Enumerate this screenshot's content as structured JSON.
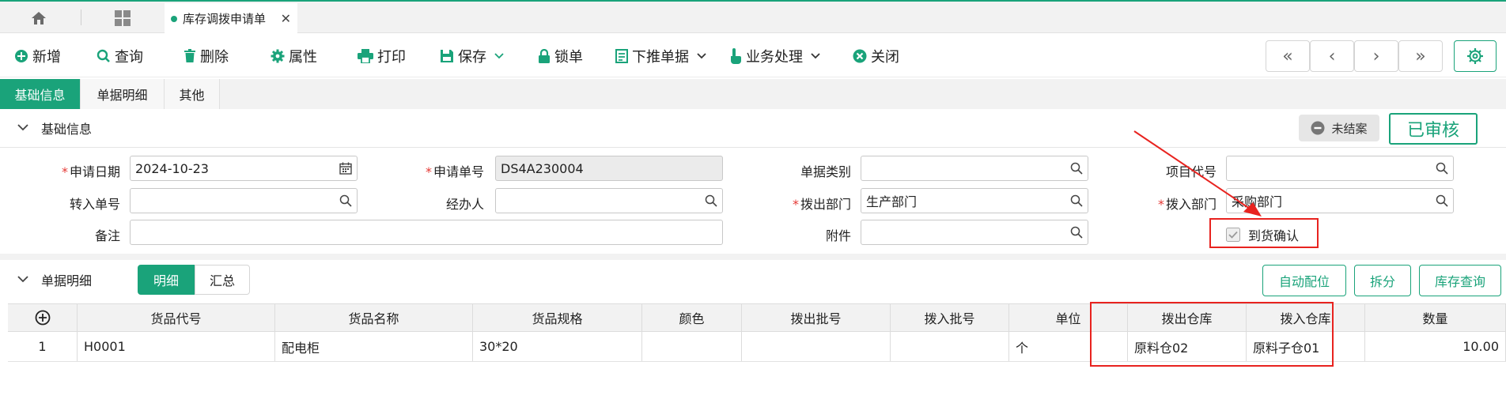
{
  "tabs": {
    "home_icon": "home-icon",
    "apps_icon": "grid-icon",
    "active_label": "库存调拨申请单",
    "close": "✕"
  },
  "toolbar": {
    "new": "新增",
    "query": "查询",
    "delete": "删除",
    "props": "属性",
    "print": "打印",
    "save": "保存",
    "lock": "锁单",
    "push_down": "下推单据",
    "business": "业务处理",
    "close": "关闭",
    "nav": [
      "«",
      "‹",
      "›",
      "»"
    ]
  },
  "section_tabs": [
    "基础信息",
    "单据明细",
    "其他"
  ],
  "basic": {
    "title": "基础信息",
    "status_open": "未结案",
    "status_approved": "已审核",
    "fields": {
      "apply_date_label": "申请日期",
      "apply_date_value": "2024-10-23",
      "apply_no_label": "申请单号",
      "apply_no_value": "DS4A230004",
      "doc_type_label": "单据类别",
      "doc_type_value": "",
      "project_label": "项目代号",
      "project_value": "",
      "in_no_label": "转入单号",
      "in_no_value": "",
      "handler_label": "经办人",
      "handler_value": "",
      "out_dept_label": "拨出部门",
      "out_dept_value": "生产部门",
      "in_dept_label": "拨入部门",
      "in_dept_value": "采购部门",
      "remark_label": "备注",
      "remark_value": "",
      "attach_label": "附件",
      "attach_value": "",
      "arrival_label": "到货确认"
    }
  },
  "detail": {
    "title": "单据明细",
    "seg": [
      "明细",
      "汇总"
    ],
    "buttons": [
      "自动配位",
      "拆分",
      "库存查询"
    ],
    "columns": [
      "货品代号",
      "货品名称",
      "货品规格",
      "颜色",
      "拨出批号",
      "拨入批号",
      "单位",
      "拨出仓库",
      "拨入仓库",
      "数量"
    ],
    "rows": [
      {
        "no": "1",
        "code": "H0001",
        "name": "配电柜",
        "spec": "30*20",
        "color": "",
        "out_batch": "",
        "in_batch": "",
        "unit": "个",
        "out_wh": "原料仓02",
        "in_wh": "原料子仓01",
        "qty": "10.00"
      }
    ]
  },
  "colors": {
    "accent": "#1aa37a",
    "annotation": "#e8231f"
  }
}
